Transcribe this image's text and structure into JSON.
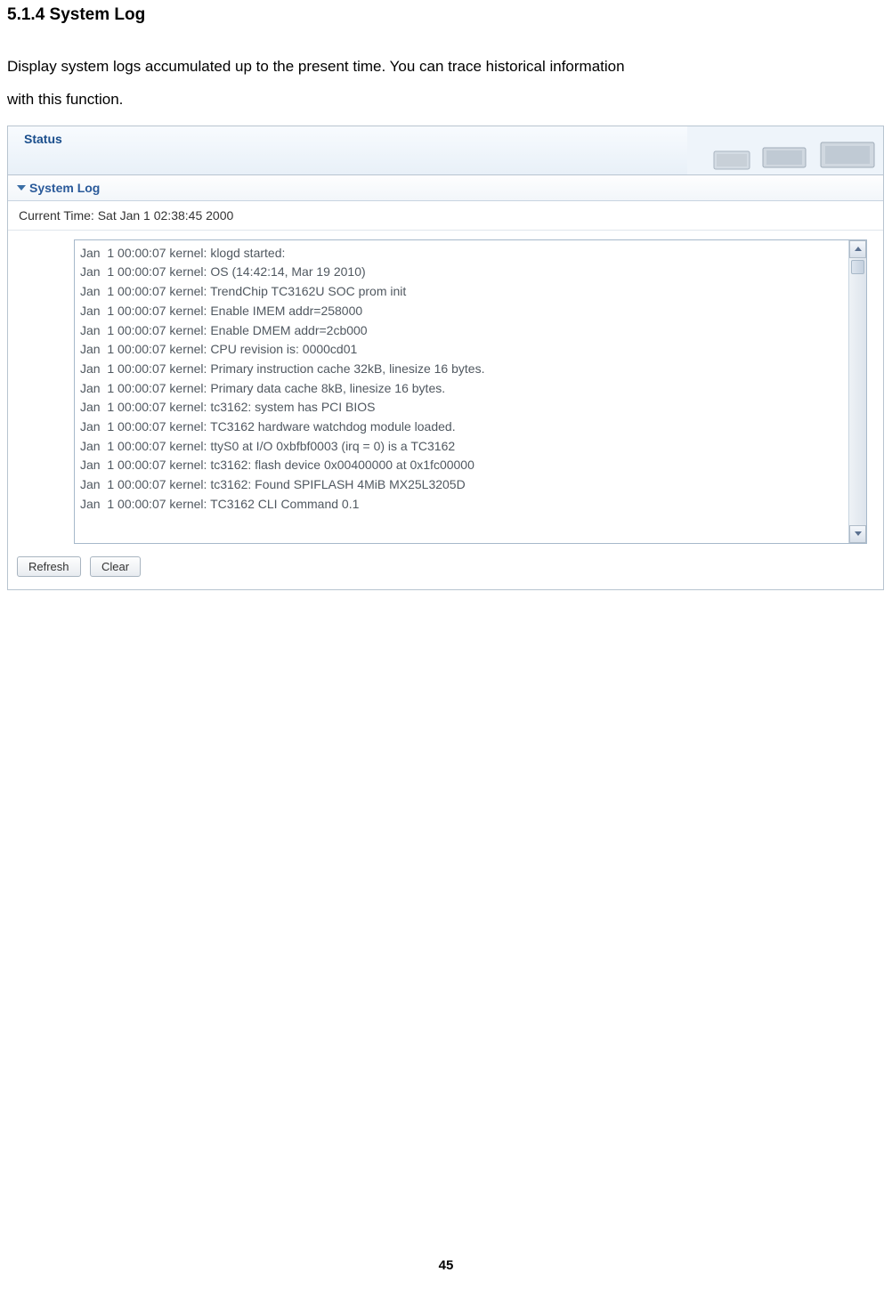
{
  "section_heading": "5.1.4 System Log",
  "intro_line1": "Display system logs accumulated up to the present time. You can trace historical information",
  "intro_line2": "with this function.",
  "status_title": "Status",
  "panel_title": "System Log",
  "current_time_label": "Current Time: Sat Jan 1 02:38:45 2000",
  "log_lines": [
    "Jan  1 00:00:07 kernel: klogd started:",
    "Jan  1 00:00:07 kernel: OS (14:42:14, Mar 19 2010)",
    "Jan  1 00:00:07 kernel: TrendChip TC3162U SOC prom init",
    "Jan  1 00:00:07 kernel: Enable IMEM addr=258000",
    "Jan  1 00:00:07 kernel: Enable DMEM addr=2cb000",
    "Jan  1 00:00:07 kernel: CPU revision is: 0000cd01",
    "Jan  1 00:00:07 kernel: Primary instruction cache 32kB, linesize 16 bytes.",
    "Jan  1 00:00:07 kernel: Primary data cache 8kB, linesize 16 bytes.",
    "Jan  1 00:00:07 kernel: tc3162: system has PCI BIOS",
    "Jan  1 00:00:07 kernel: TC3162 hardware watchdog module loaded.",
    "Jan  1 00:00:07 kernel: ttyS0 at I/O 0xbfbf0003 (irq = 0) is a TC3162",
    "Jan  1 00:00:07 kernel: tc3162: flash device 0x00400000 at 0x1fc00000",
    "Jan  1 00:00:07 kernel: tc3162: Found SPIFLASH 4MiB MX25L3205D",
    "Jan  1 00:00:07 kernel: TC3162 CLI Command 0.1"
  ],
  "buttons": {
    "refresh": "Refresh",
    "clear": "Clear"
  },
  "page_number": "45"
}
